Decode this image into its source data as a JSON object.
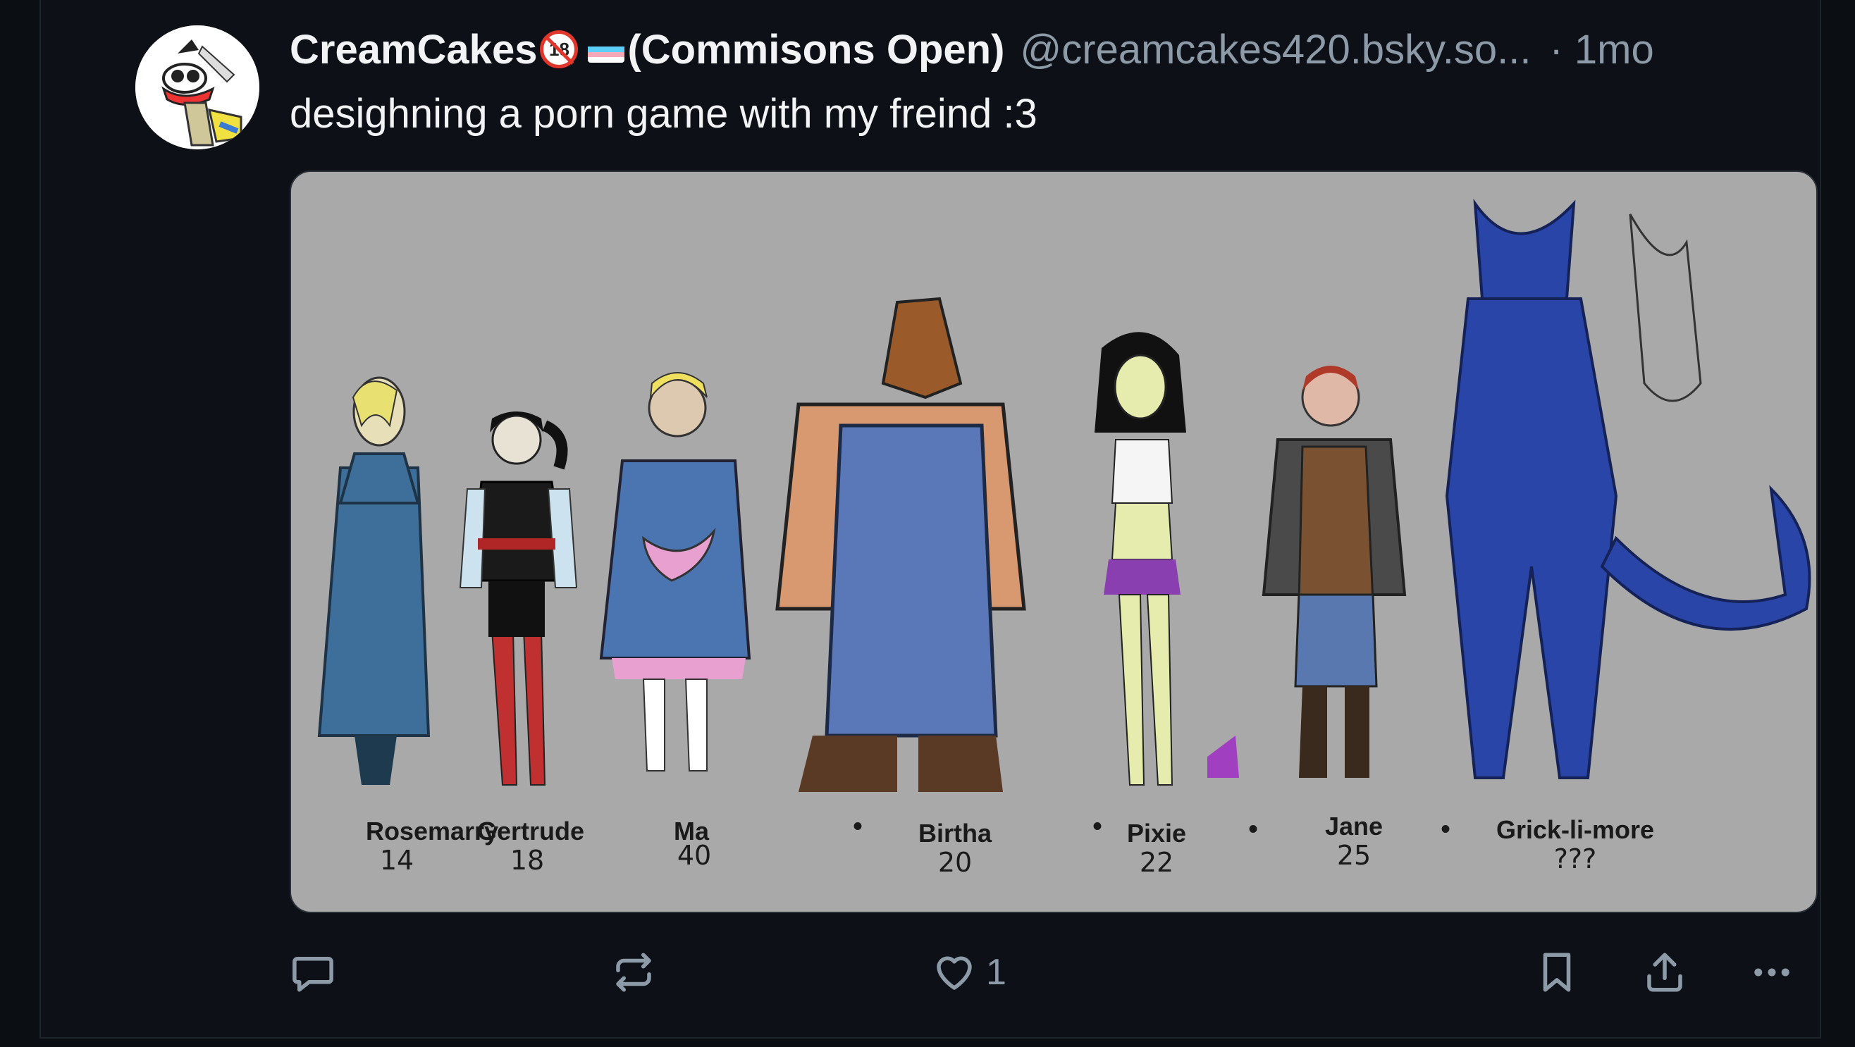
{
  "post": {
    "author_name": "CreamCakes",
    "author_tag": "(Commisons Open)",
    "handle": "@creamcakes420.bsky.so...",
    "time": "· 1mo",
    "text": "desighning a porn game with my freind :3"
  },
  "media": {
    "characters": [
      {
        "name": "Rosemarry",
        "age": "14"
      },
      {
        "name": "Gertrude",
        "age": "18"
      },
      {
        "name": "Ma",
        "age": "40"
      },
      {
        "name": "Birtha",
        "age": "20"
      },
      {
        "name": "Pixie",
        "age": "22"
      },
      {
        "name": "Jane",
        "age": "25"
      },
      {
        "name": "Grick-li-more",
        "age": "???"
      }
    ],
    "separator": "•"
  },
  "actions": {
    "reply_icon": "reply-icon",
    "repost_icon": "repost-icon",
    "like_icon": "heart-icon",
    "like_count": "1",
    "bookmark_icon": "bookmark-icon",
    "share_icon": "share-icon",
    "more_icon": "more-icon"
  }
}
